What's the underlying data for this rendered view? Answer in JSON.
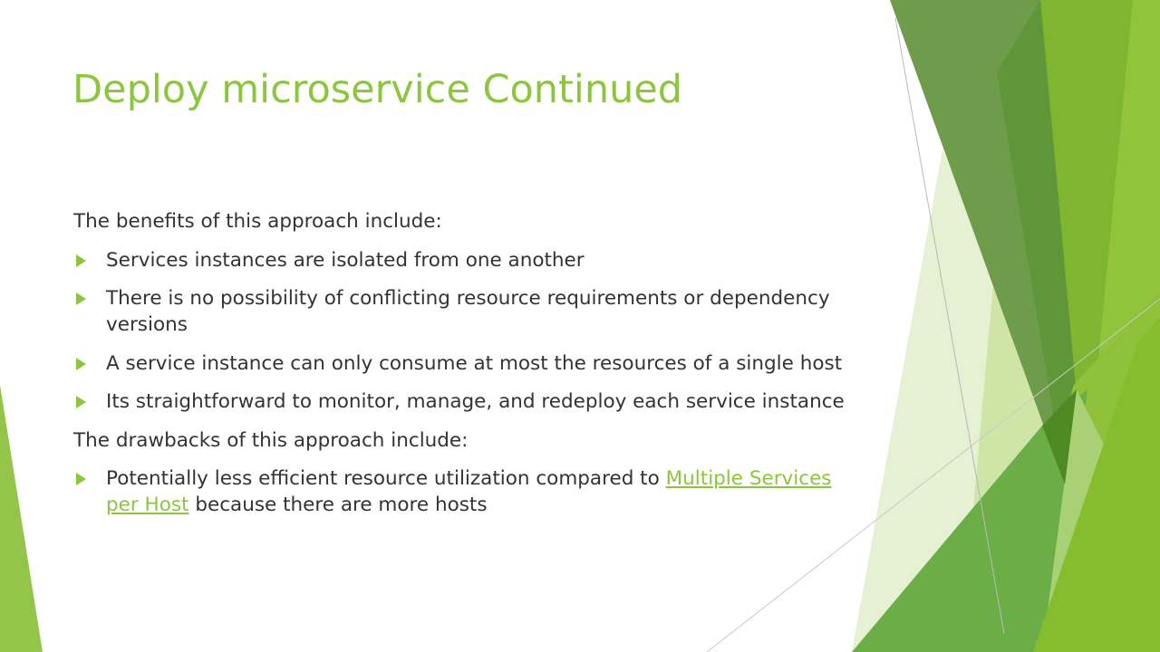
{
  "slide": {
    "title": "Deploy microservice Continued",
    "benefits_intro": "The benefits of this approach include:",
    "benefits": [
      "Services instances are isolated from one another",
      "There is no possibility of conflicting resource requirements or dependency versions",
      "A service instance can only consume at most the resources of a single host",
      "Its straightforward to monitor, manage, and redeploy each service instance"
    ],
    "drawbacks_intro": "The drawbacks of this approach include:",
    "drawbacks": [
      {
        "before_link": "Potentially less efficient resource utilization compared to ",
        "link_text": "Multiple Services per Host",
        "after_link": " because there are more hosts"
      }
    ]
  },
  "colors": {
    "title": "#8cc63f",
    "bullet": "#8cc63f",
    "body_text": "#333333",
    "link": "#8cc63f"
  },
  "icons": {
    "bullet": "triangle-bullet-icon"
  }
}
